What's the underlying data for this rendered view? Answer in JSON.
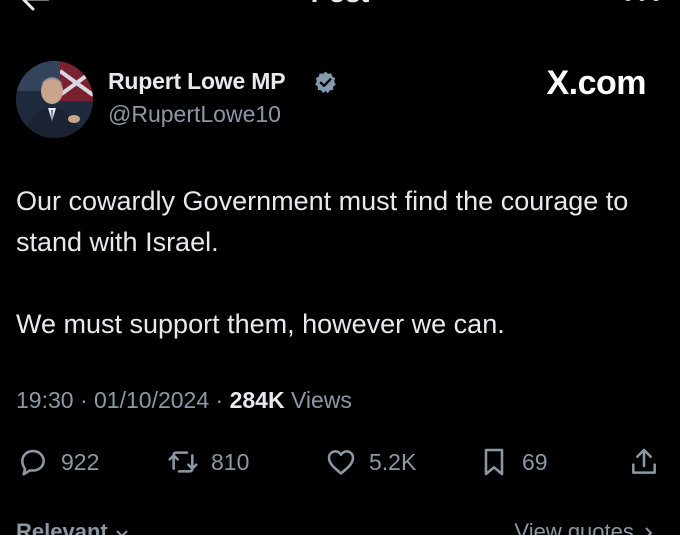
{
  "header": {
    "title": "Post"
  },
  "author": {
    "name": "Rupert Lowe MP",
    "handle": "@RupertLowe10"
  },
  "watermark": "X.com",
  "tweet": {
    "paragraphs": [
      "Our cowardly Government must find the courage to stand with Israel.",
      "We must support them, however we can."
    ],
    "time": "19:30",
    "date": "01/10/2024",
    "views_count": "284K",
    "views_label": "Views"
  },
  "actions": {
    "replies": "922",
    "reposts": "810",
    "likes": "5.2K",
    "bookmarks": "69"
  },
  "footer": {
    "sort_label": "Relevant",
    "quotes_label": "View quotes"
  },
  "colors": {
    "background": "#000000",
    "text": "#e7e9ea",
    "muted": "#8b98a5",
    "verified": "#829aab"
  },
  "icons": [
    "back-arrow-icon",
    "more-icon",
    "verified-badge-icon",
    "reply-icon",
    "repost-icon",
    "like-icon",
    "bookmark-icon",
    "share-icon",
    "chevron-down-icon",
    "chevron-right-icon"
  ]
}
